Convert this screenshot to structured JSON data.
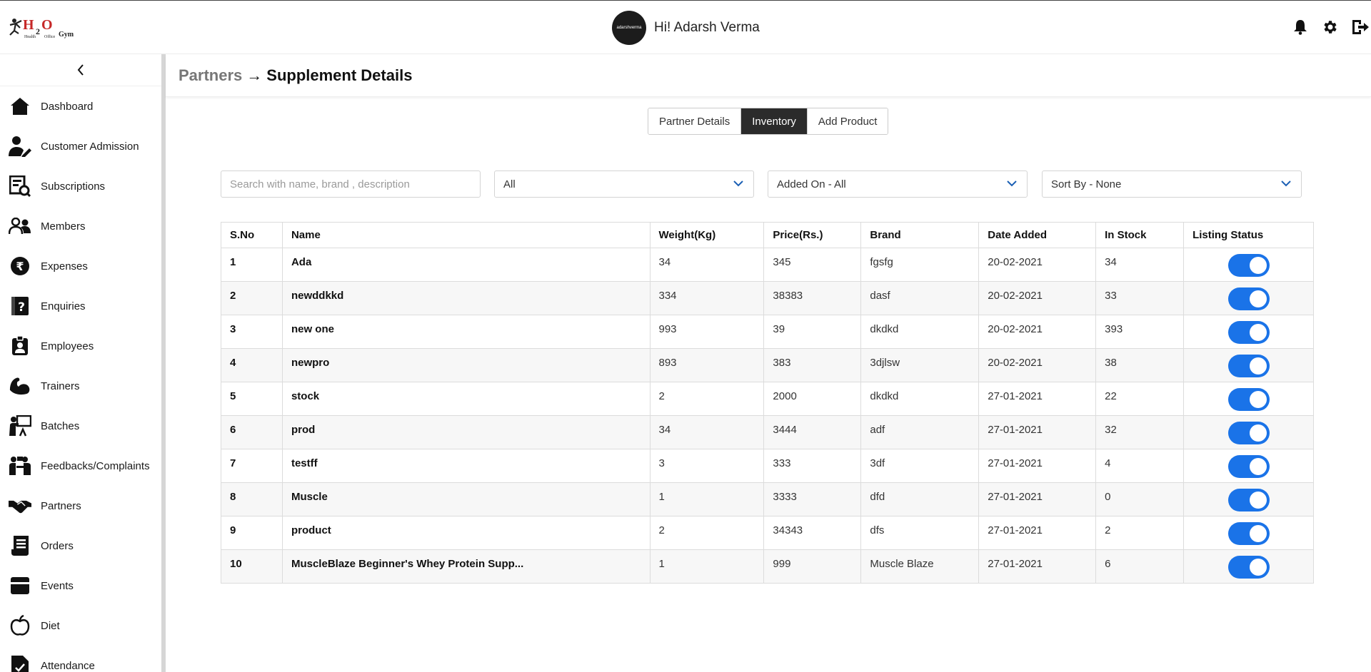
{
  "app": {
    "logo_text": "H2O Health Office Gym",
    "greeting": "Hi! Adarsh Verma",
    "avatar_text": "adarshverma"
  },
  "sidebar": {
    "items": [
      {
        "label": "Dashboard",
        "icon": "home-icon"
      },
      {
        "label": "Customer Admission",
        "icon": "user-edit-icon"
      },
      {
        "label": "Subscriptions",
        "icon": "subscription-icon"
      },
      {
        "label": "Members",
        "icon": "members-icon"
      },
      {
        "label": "Expenses",
        "icon": "rupee-icon"
      },
      {
        "label": "Enquiries",
        "icon": "enquiry-icon"
      },
      {
        "label": "Employees",
        "icon": "id-badge-icon"
      },
      {
        "label": "Trainers",
        "icon": "muscle-icon"
      },
      {
        "label": "Batches",
        "icon": "batch-icon"
      },
      {
        "label": "Feedbacks/Complaints",
        "icon": "feedback-icon"
      },
      {
        "label": "Partners",
        "icon": "handshake-icon"
      },
      {
        "label": "Orders",
        "icon": "orders-icon"
      },
      {
        "label": "Events",
        "icon": "calendar-icon"
      },
      {
        "label": "Diet",
        "icon": "apple-icon"
      },
      {
        "label": "Attendance",
        "icon": "attendance-icon"
      }
    ]
  },
  "header": {
    "crumb": "Partners",
    "arrow": "→",
    "title": "Supplement Details"
  },
  "tabs": [
    {
      "label": "Partner Details",
      "active": false
    },
    {
      "label": "Inventory",
      "active": true
    },
    {
      "label": "Add Product",
      "active": false
    }
  ],
  "filters": {
    "search_placeholder": "Search with name, brand , description",
    "category": "All",
    "added_on": "Added On - All",
    "sort_by": "Sort By - None"
  },
  "table": {
    "columns": [
      "S.No",
      "Name",
      "Weight(Kg)",
      "Price(Rs.)",
      "Brand",
      "Date Added",
      "In Stock",
      "Listing Status"
    ],
    "rows": [
      [
        "1",
        "Ada",
        "34",
        "345",
        "fgsfg",
        "20-02-2021",
        "34"
      ],
      [
        "2",
        "newddkkd",
        "334",
        "38383",
        "dasf",
        "20-02-2021",
        "33"
      ],
      [
        "3",
        "new one",
        "993",
        "39",
        "dkdkd",
        "20-02-2021",
        "393"
      ],
      [
        "4",
        "newpro",
        "893",
        "383",
        "3djlsw",
        "20-02-2021",
        "38"
      ],
      [
        "5",
        "stock",
        "2",
        "2000",
        "dkdkd",
        "27-01-2021",
        "22"
      ],
      [
        "6",
        "prod",
        "34",
        "3444",
        "adf",
        "27-01-2021",
        "32"
      ],
      [
        "7",
        "testff",
        "3",
        "333",
        "3df",
        "27-01-2021",
        "4"
      ],
      [
        "8",
        "Muscle",
        "1",
        "3333",
        "dfd",
        "27-01-2021",
        "0"
      ],
      [
        "9",
        "product",
        "2",
        "34343",
        "dfs",
        "27-01-2021",
        "2"
      ],
      [
        "10",
        "MuscleBlaze Beginner's Whey Protein Supp...",
        "1",
        "999",
        "Muscle Blaze",
        "27-01-2021",
        "6"
      ]
    ],
    "listing_status_on": [
      true,
      true,
      true,
      true,
      true,
      true,
      true,
      true,
      true,
      true
    ]
  },
  "colors": {
    "toggle_on": "#1a73e8",
    "active_tab": "#2b2b2b",
    "logo_red": "#c62828"
  }
}
